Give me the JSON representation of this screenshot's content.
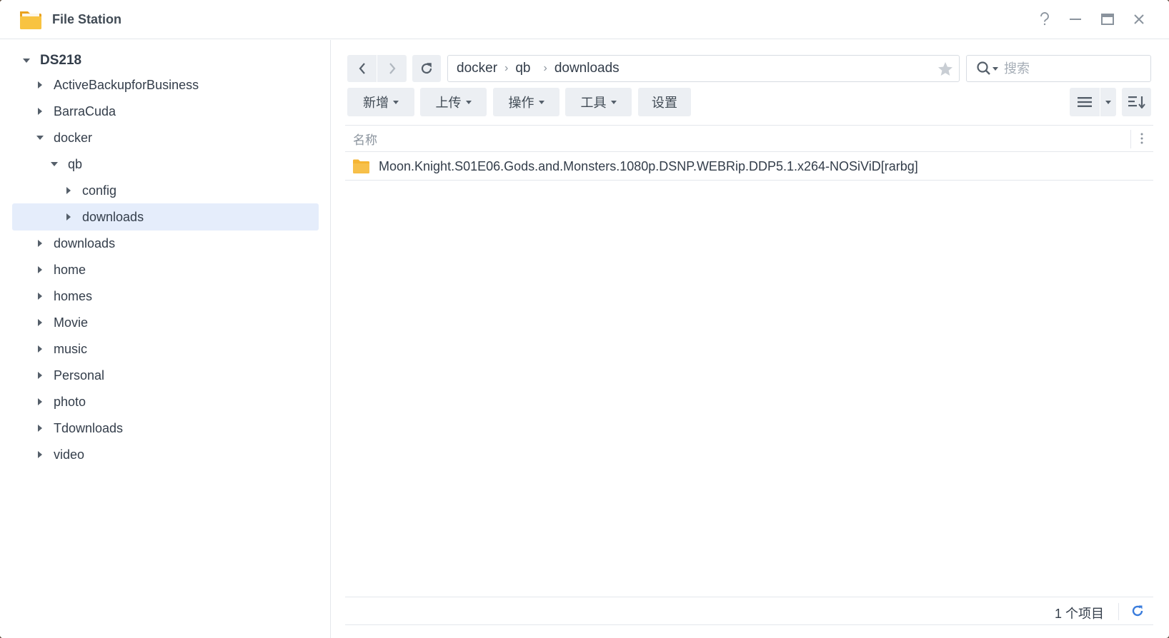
{
  "window": {
    "title": "File Station"
  },
  "sidebar": {
    "root": "DS218",
    "items": [
      {
        "label": "ActiveBackupforBusiness",
        "level": 1,
        "expanded": false
      },
      {
        "label": "BarraCuda",
        "level": 1,
        "expanded": false
      },
      {
        "label": "docker",
        "level": 1,
        "expanded": true
      },
      {
        "label": "qb",
        "level": 2,
        "expanded": true
      },
      {
        "label": "config",
        "level": 3,
        "expanded": false
      },
      {
        "label": "downloads",
        "level": 3,
        "expanded": false,
        "selected": true
      },
      {
        "label": "downloads",
        "level": 1,
        "expanded": false
      },
      {
        "label": "home",
        "level": 1,
        "expanded": false
      },
      {
        "label": "homes",
        "level": 1,
        "expanded": false
      },
      {
        "label": "Movie",
        "level": 1,
        "expanded": false
      },
      {
        "label": "music",
        "level": 1,
        "expanded": false
      },
      {
        "label": "Personal",
        "level": 1,
        "expanded": false
      },
      {
        "label": "photo",
        "level": 1,
        "expanded": false
      },
      {
        "label": "Tdownloads",
        "level": 1,
        "expanded": false
      },
      {
        "label": "video",
        "level": 1,
        "expanded": false
      }
    ]
  },
  "pathbar": {
    "crumbs": [
      "docker",
      "qb",
      "downloads"
    ]
  },
  "search": {
    "placeholder": "搜索"
  },
  "toolbar": {
    "create_label": "新增",
    "upload_label": "上传",
    "action_label": "操作",
    "tools_label": "工具",
    "settings_label": "设置"
  },
  "grid": {
    "name_header": "名称",
    "files": [
      {
        "name": "Moon.Knight.S01E06.Gods.and.Monsters.1080p.DSNP.WEBRip.DDP5.1.x264-NOSiViD[rarbg]",
        "type": "folder"
      }
    ]
  },
  "status": {
    "count_number": "1",
    "count_unit": "个项目"
  },
  "colors": {
    "accent": "#3a7cdc",
    "folder": "#f5b533",
    "selected_bg": "#e5edfb"
  }
}
